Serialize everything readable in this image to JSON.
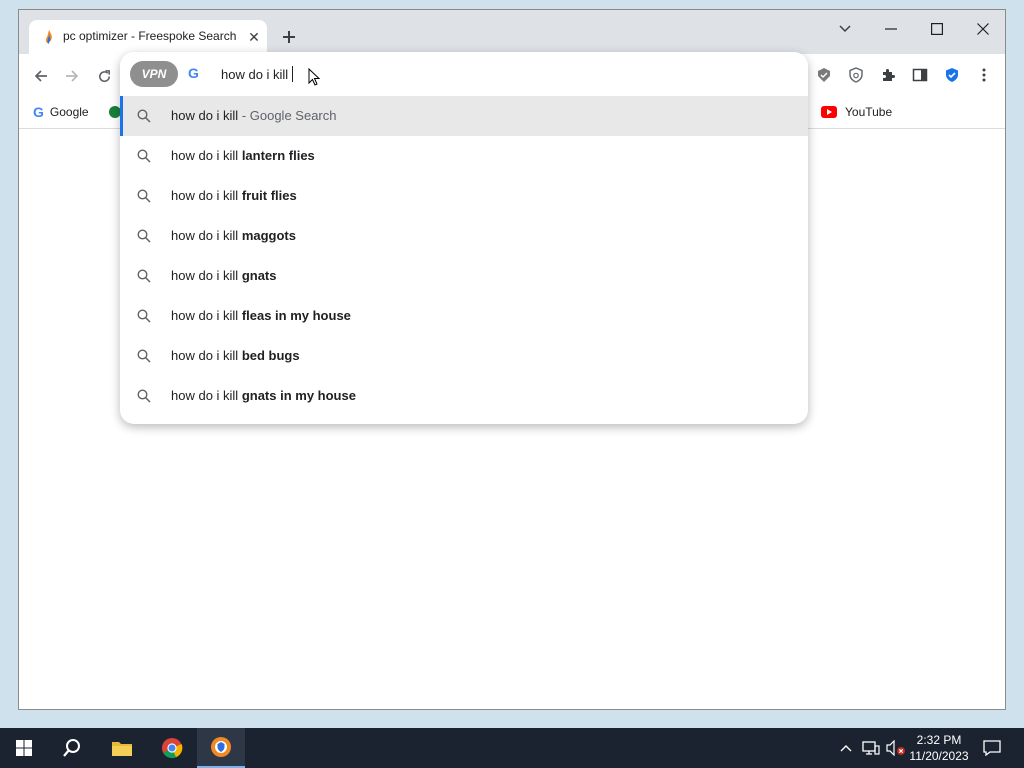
{
  "browser": {
    "tab": {
      "title": "pc optimizer - Freespoke Search"
    },
    "omnibox": {
      "vpn_label": "VPN",
      "input_value": "how do i kill",
      "suggestions": [
        {
          "prefix": "how do i kill",
          "bold": "",
          "suffix": " - Google Search",
          "selected": true
        },
        {
          "prefix": "how do i kill ",
          "bold": "lantern flies",
          "suffix": ""
        },
        {
          "prefix": "how do i kill ",
          "bold": "fruit flies",
          "suffix": ""
        },
        {
          "prefix": "how do i kill ",
          "bold": "maggots",
          "suffix": ""
        },
        {
          "prefix": "how do i kill ",
          "bold": "gnats",
          "suffix": ""
        },
        {
          "prefix": "how do i kill ",
          "bold": "fleas in my house",
          "suffix": ""
        },
        {
          "prefix": "how do i kill ",
          "bold": "bed bugs",
          "suffix": ""
        },
        {
          "prefix": "how do i kill ",
          "bold": "gnats in my house",
          "suffix": ""
        }
      ]
    },
    "bookmarks": [
      {
        "label": "Google",
        "icon": "google-icon"
      },
      {
        "label": "YouTube",
        "icon": "youtube-icon"
      }
    ]
  },
  "taskbar": {
    "time": "2:32 PM",
    "date": "11/20/2023"
  },
  "colors": {
    "accent": "#1a73e8",
    "taskbar": "#1c2330",
    "tab_strip": "#dee1e6"
  }
}
